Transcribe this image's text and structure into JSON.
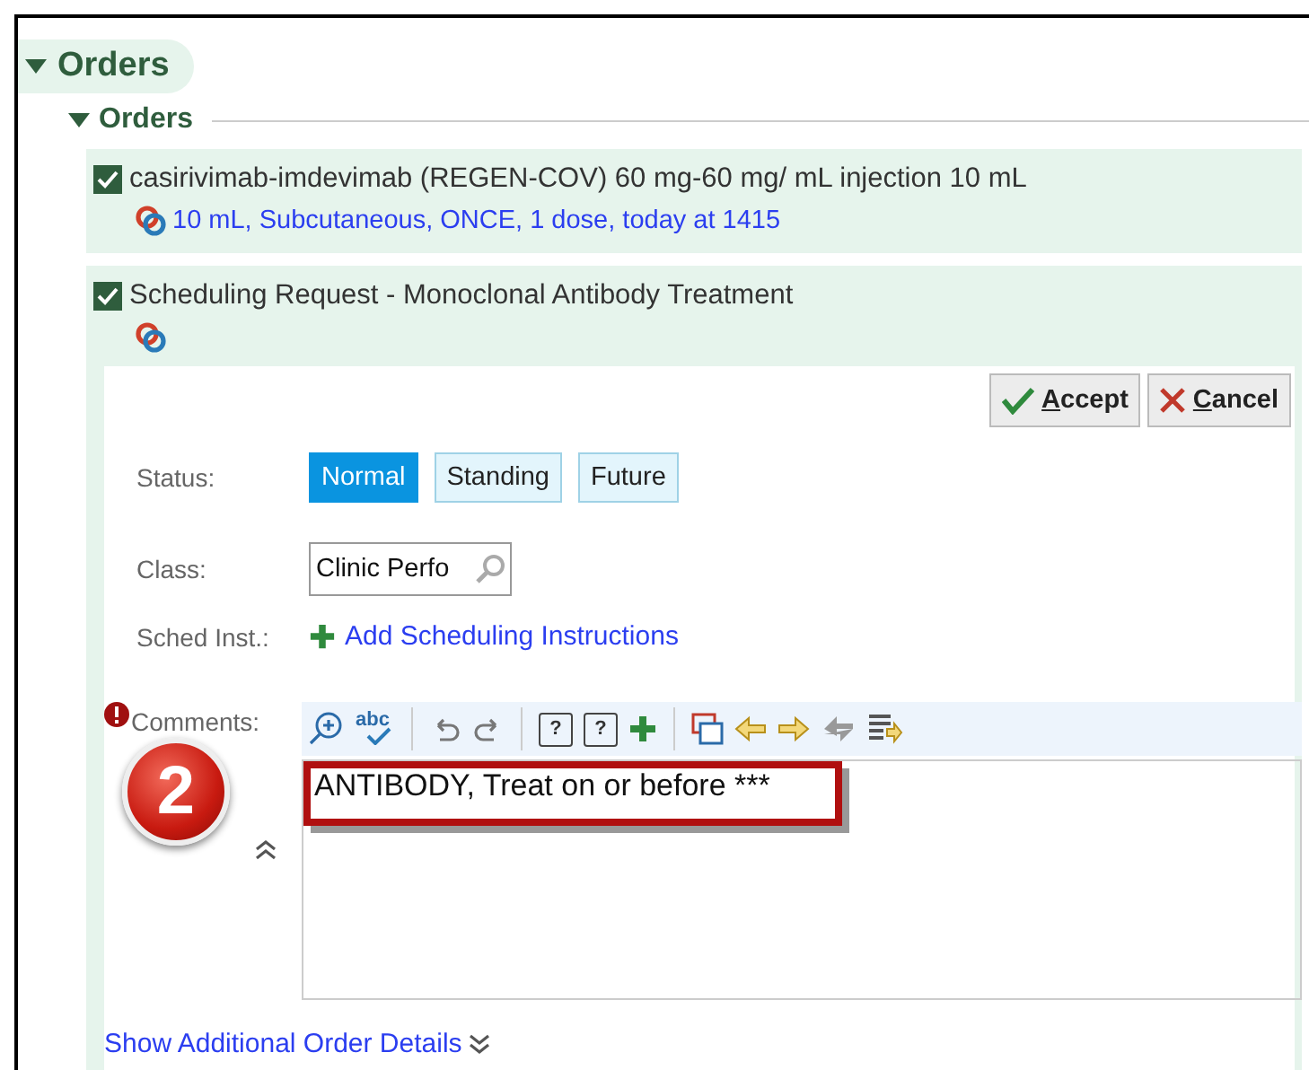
{
  "section": {
    "title": "Orders",
    "expanded": true
  },
  "subsection": {
    "title": "Orders",
    "expanded": true
  },
  "orders": [
    {
      "checked": true,
      "name": "casirivimab-imdevimab (REGEN-COV) 60 mg-60 mg/ mL injection 10 mL",
      "details": "10 mL, Subcutaneous, ONCE, 1 dose, today at 1415"
    },
    {
      "checked": true,
      "name": "Scheduling Request - Monoclonal Antibody Treatment"
    }
  ],
  "form": {
    "actions": [
      {
        "kind": "accept",
        "label": "Accept",
        "mnemonic": true
      },
      {
        "kind": "cancel",
        "label": "Cancel",
        "mnemonic": true
      }
    ],
    "status_label": "Status:",
    "statuses": [
      {
        "label": "Normal",
        "selected": true
      },
      {
        "label": "Standing",
        "selected": false
      },
      {
        "label": "Future",
        "selected": false
      }
    ],
    "class_label": "Class:",
    "class_value": "Clinic Perfo",
    "sched_label": "Sched Inst.:",
    "sched_link": "Add Scheduling Instructions",
    "comments_label": "Comments:",
    "comments_required": true,
    "toolbar": [
      {
        "kind": "zoom"
      },
      {
        "kind": "spell",
        "text": "abc"
      },
      {
        "kind": "sep"
      },
      {
        "kind": "undo"
      },
      {
        "kind": "redo"
      },
      {
        "kind": "sep"
      },
      {
        "kind": "help",
        "text": "?"
      },
      {
        "kind": "help2",
        "text": "?"
      },
      {
        "kind": "add"
      },
      {
        "kind": "sep"
      },
      {
        "kind": "window"
      },
      {
        "kind": "prev"
      },
      {
        "kind": "next"
      },
      {
        "kind": "skip"
      },
      {
        "kind": "list"
      }
    ],
    "comments_value": "ANTIBODY, Treat on or before ***",
    "more_link": "Show Additional Order Details"
  },
  "callout": {
    "label": "2"
  }
}
